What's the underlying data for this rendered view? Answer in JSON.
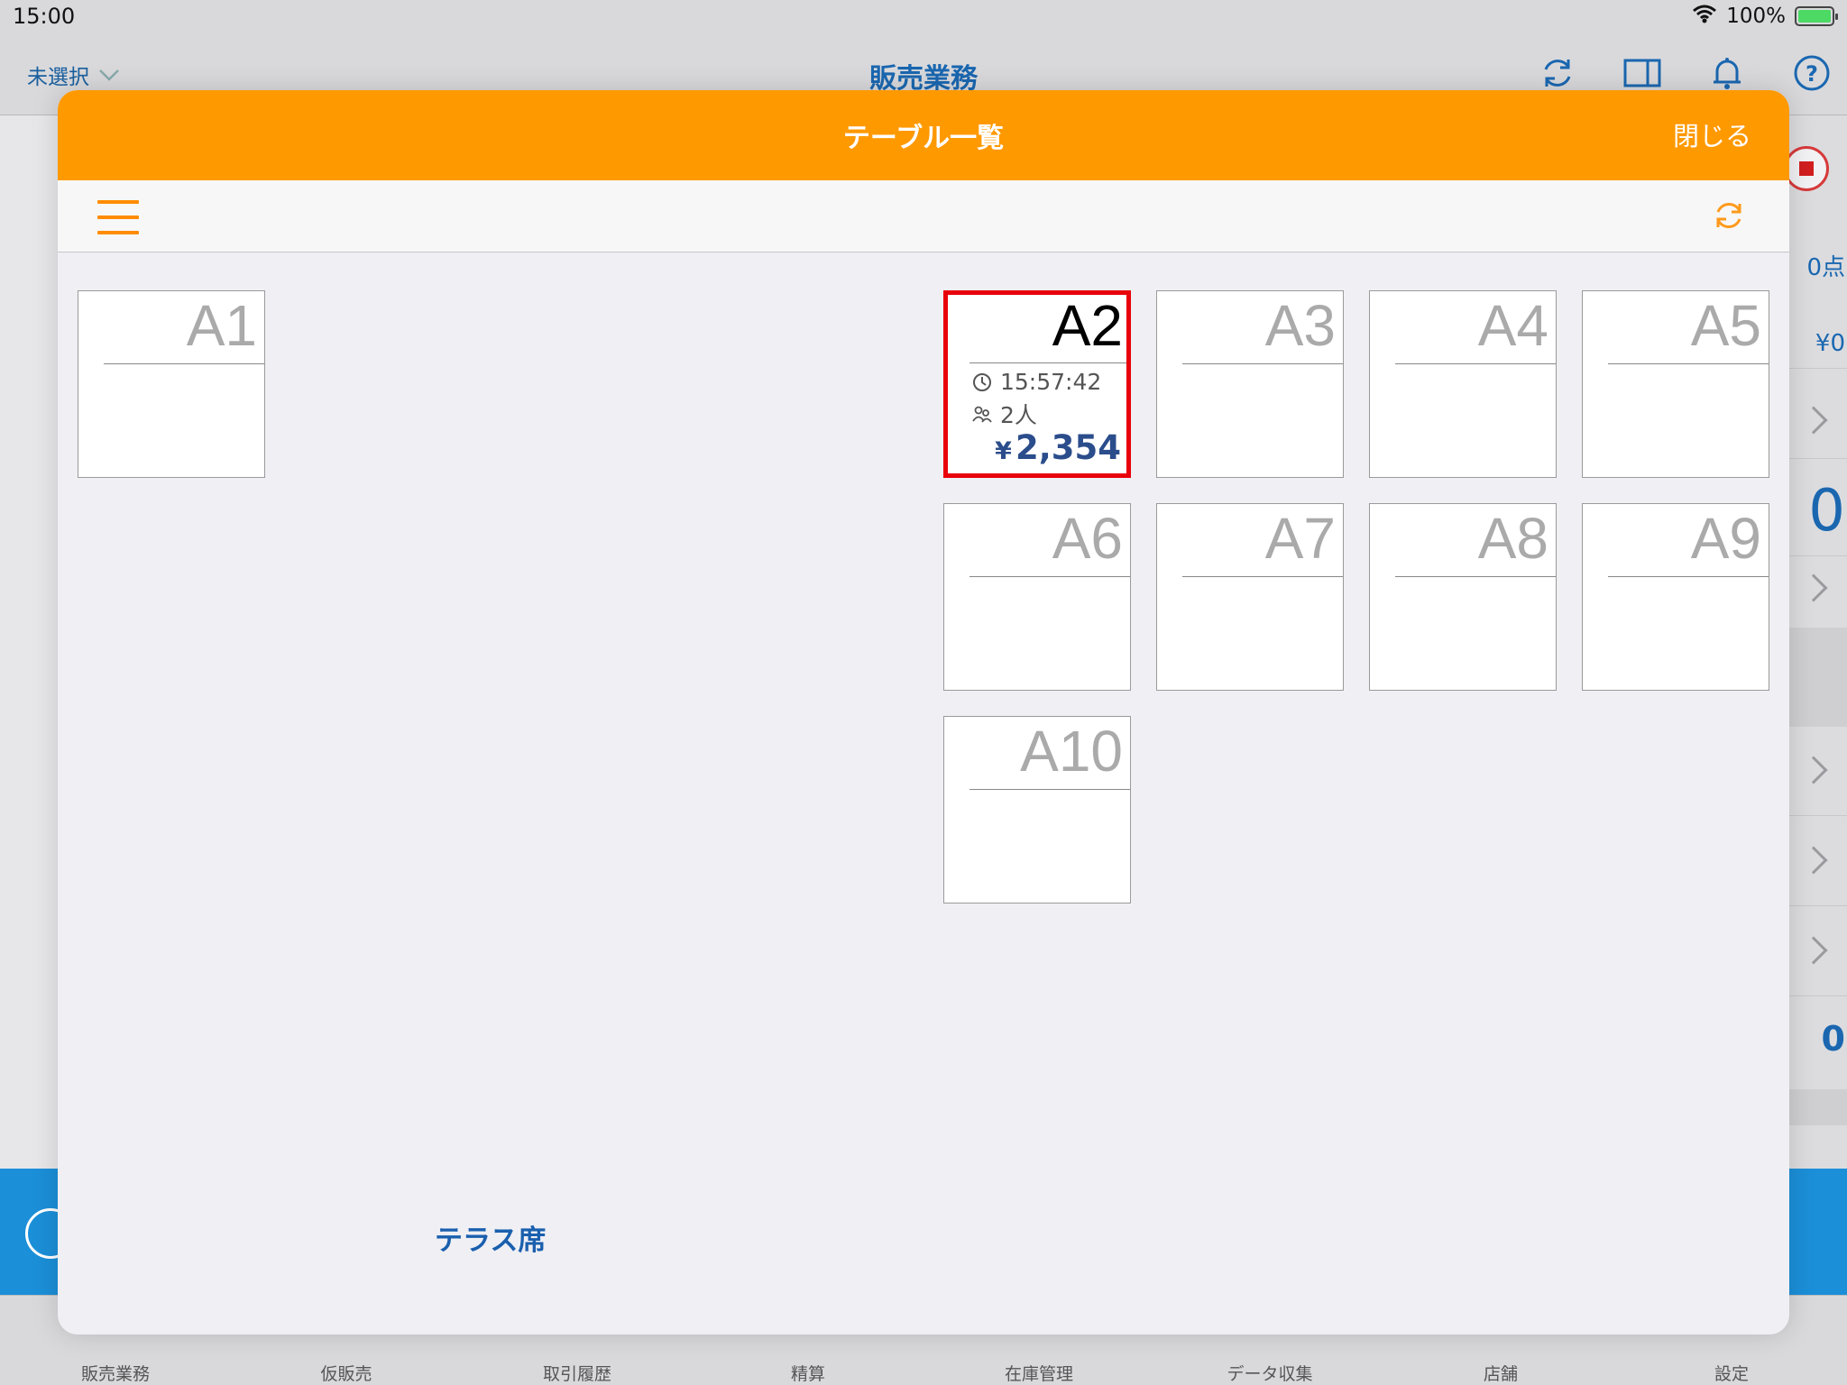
{
  "status_bar": {
    "time": "15:00",
    "battery": "100%"
  },
  "app_header": {
    "store_select": "未選択",
    "title": "販売業務"
  },
  "background_peek": {
    "points_suffix": "0点",
    "amount": "¥0",
    "big_digit_1": "0",
    "big_digit_2": "0"
  },
  "modal": {
    "title": "テーブル一覧",
    "close_label": "閉じる",
    "active_table": {
      "time": "15:57:42",
      "guests": "2人",
      "currency": "¥",
      "amount": "2,354"
    },
    "tables": [
      "A1",
      "A2",
      "A3",
      "A4",
      "A5",
      "A6",
      "A7",
      "A8",
      "A9",
      "A10"
    ],
    "section_label": "テラス席"
  },
  "tab_bar": [
    "販売業務",
    "仮販売",
    "取引履歴",
    "精算",
    "在庫管理",
    "データ収集",
    "店舗",
    "設定"
  ],
  "colors": {
    "header_orange": "#ff9900",
    "active_border": "#e8000b",
    "amount_blue": "#2b4d8c",
    "link_blue": "#1a67b0"
  },
  "icons": [
    "wifi-icon",
    "battery-icon",
    "chevron-down-icon",
    "sync-icon",
    "split-view-icon",
    "bell-icon",
    "help-icon",
    "menu-icon",
    "refresh-icon",
    "clock-icon",
    "guests-icon"
  ]
}
